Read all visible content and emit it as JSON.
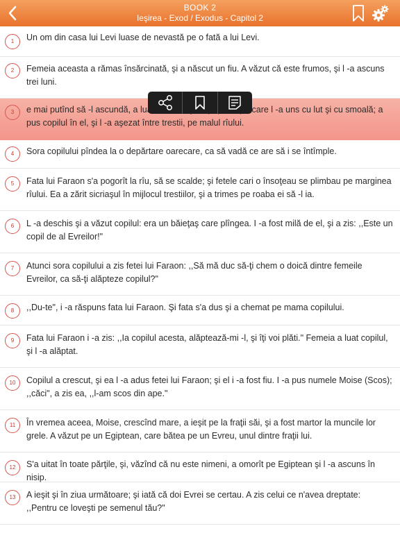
{
  "header": {
    "book": "BOOK 2",
    "chapter": "Ieşirea - Exod / Exodus - Capitol 2"
  },
  "colors": {
    "header_top": "#f4a05e",
    "header_bottom": "#e8722c",
    "highlight": "#f3958a",
    "verse_number": "#c0392b"
  },
  "verses": [
    {
      "num": "1",
      "text": "Un om din casa lui Levi luase de nevastă pe o fată a lui Levi."
    },
    {
      "num": "2",
      "text": "Femeia aceasta a rămas însărcinată, şi a născut un fiu. A văzut că este frumos, şi l -a ascuns trei luni."
    },
    {
      "num": "3",
      "text": "e mai putînd să -l ascundă, a luat un sicriaş de papură, pe care l -a uns cu lut şi cu smoală; a pus copilul în el, şi l -a aşezat între trestii, pe malul rîului."
    },
    {
      "num": "4",
      "text": "Sora copilului pîndea la o depărtare oarecare, ca să vadă ce are să i se întîmple."
    },
    {
      "num": "5",
      "text": "Fata lui Faraon s'a pogorît la rîu, să se scalde; şi fetele cari o însoţeau se plimbau pe marginea rîului. Ea a zărit sicriaşul în mijlocul trestiilor, şi a trimes pe roaba ei să -l ia."
    },
    {
      "num": "6",
      "text": "L -a deschis şi a văzut copilul: era un băieţaş care plîngea. I -a fost milă de el, şi a zis: ,,Este un copil de al Evreilor!\""
    },
    {
      "num": "7",
      "text": "Atunci sora copilului a zis fetei lui Faraon: ,,Să mă duc să-ţi chem o doică dintre femeile Evreilor, ca să-ţi alăpteze copilul?\""
    },
    {
      "num": "8",
      "text": ",,Du-te\", i -a răspuns fata lui Faraon. Şi fata s'a dus şi a chemat pe mama copilului."
    },
    {
      "num": "9",
      "text": "Fata lui Faraon i -a zis: ,,Ia copilul acesta, alăptează-mi -l, şi îţi voi plăti.\" Femeia a luat copilul, şi l -a alăptat."
    },
    {
      "num": "10",
      "text": "Copilul a crescut, şi ea l -a adus fetei lui Faraon; şi el i -a fost fiu. I -a pus numele Moise (Scos); ,,căci\", a zis ea, ,,l-am scos din ape.\""
    },
    {
      "num": "11",
      "text": "În vremea aceea, Moise, crescînd mare, a ieşit pe la fraţii săi, şi a fost martor la muncile lor grele. A văzut pe un Egiptean, care bătea pe un Evreu, unul dintre fraţii lui."
    },
    {
      "num": "12",
      "text": "S'a uitat în toate părţile, şi, văzînd că nu este nimeni, a omorît pe Egiptean şi l -a ascuns în nisip."
    },
    {
      "num": "13",
      "text": "A ieşit şi în ziua următoare; şi iată că doi Evrei se certau. A zis celui ce n'avea dreptate: ,,Pentru ce loveşti pe semenul tău?\""
    }
  ]
}
